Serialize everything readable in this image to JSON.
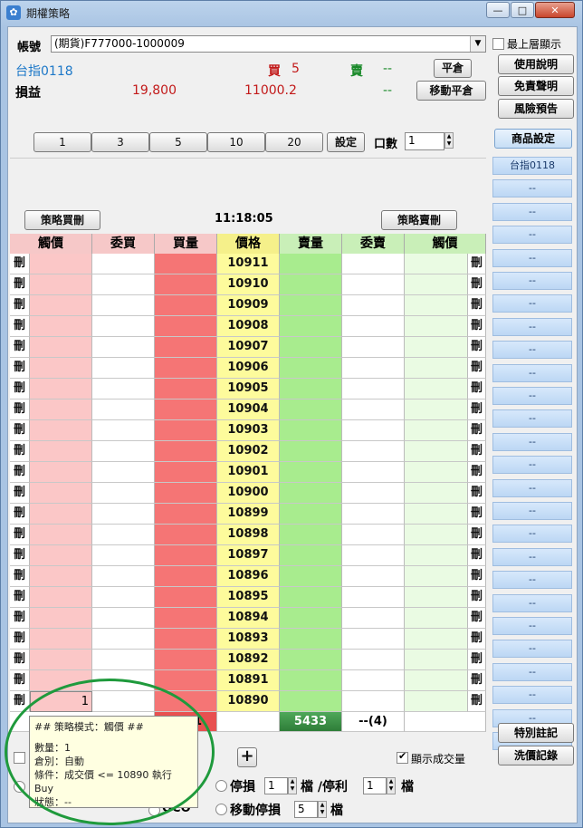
{
  "window": {
    "title": "期權策略",
    "minimize": "—",
    "maximize": "□",
    "close": "✕"
  },
  "account": {
    "label": "帳號",
    "value": "(期貨)F777000-1000009",
    "topmost": "最上層顯示"
  },
  "product": {
    "name": "台指0118",
    "buy_label": "買",
    "buy_value": "5",
    "sell_label": "賣",
    "sell_value": "--",
    "flatten": "平倉"
  },
  "pnl": {
    "label": "損益",
    "value1": "19,800",
    "value2": "11000.2",
    "value3": "--",
    "move_flatten": "移動平倉"
  },
  "right_buttons": [
    "使用說明",
    "免責聲明",
    "風險預告"
  ],
  "product_setting": "商品設定",
  "side_list": [
    "台指0118",
    "--",
    "--",
    "--",
    "--",
    "--",
    "--",
    "--",
    "--",
    "--",
    "--",
    "--",
    "--",
    "--",
    "--",
    "--",
    "--",
    "--",
    "--",
    "--",
    "--",
    "--",
    "--",
    "--",
    "--",
    "--"
  ],
  "qty_buttons": [
    "1",
    "3",
    "5",
    "10",
    "20"
  ],
  "set_button": "設定",
  "lots": {
    "label": "口數",
    "value": "1"
  },
  "strategy_buy": "策略買刪",
  "strategy_sell": "策略賣刪",
  "time": "11:18:05",
  "columns": [
    "觸價",
    "委買",
    "買量",
    "價格",
    "賣量",
    "委賣",
    "觸價"
  ],
  "delete_label": "刪",
  "prices": [
    "10911",
    "10910",
    "10909",
    "10908",
    "10907",
    "10906",
    "10905",
    "10904",
    "10903",
    "10902",
    "10901",
    "10900",
    "10899",
    "10898",
    "10897",
    "10896",
    "10895",
    "10894",
    "10893",
    "10892",
    "10891",
    "10890"
  ],
  "trigger_value": "1",
  "summary": {
    "buy_qty": "5851",
    "sell_qty": "5433",
    "sell_order": "--(4)"
  },
  "tooltip": {
    "line1": "## 策略模式：觸價 ##",
    "line2": "數量：1",
    "line3": "倉別：自動",
    "line4": "條件：成交價 <= 10890 執行 Buy",
    "line5": "狀態：--"
  },
  "plus_button": "+",
  "show_volume": "顯示成交量",
  "special_note": "特別註記",
  "wash_record": "洗價記錄",
  "stop_loss": {
    "label": "停損",
    "value": "1",
    "unit_slash": "檔 /停利",
    "value2": "1",
    "unit": "檔"
  },
  "trailing_stop": {
    "label": "移動停損",
    "value": "5",
    "unit": "檔"
  },
  "oco_label": "OCO"
}
